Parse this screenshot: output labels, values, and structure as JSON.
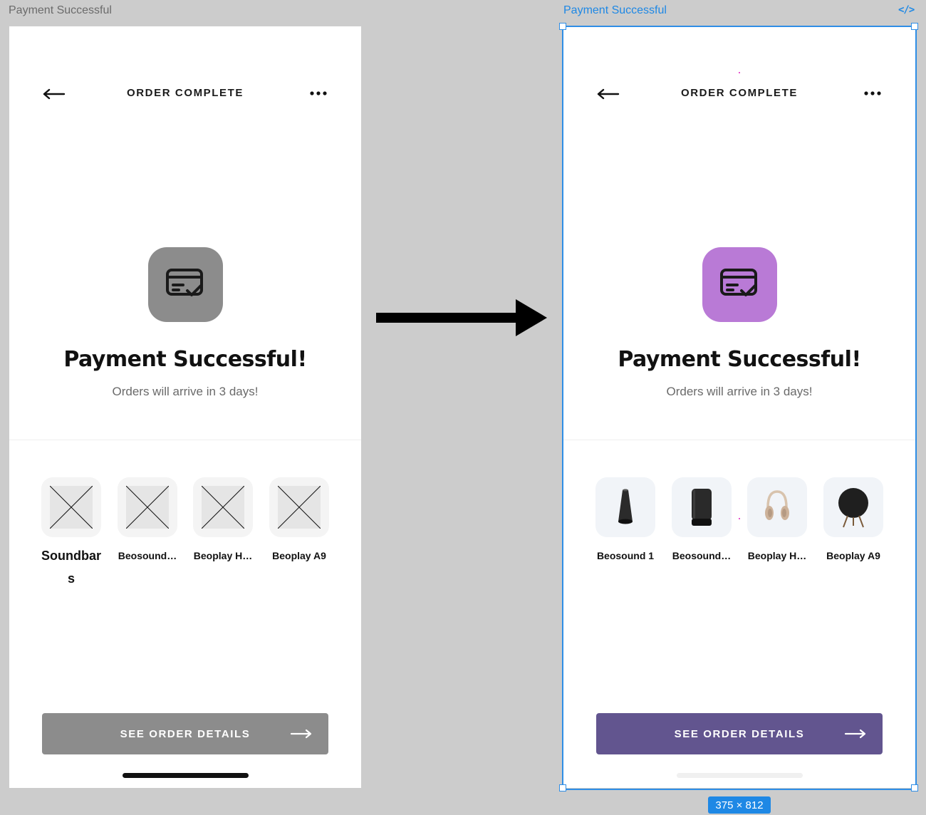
{
  "canvas": {
    "left_frame_label": "Payment Successful",
    "right_frame_label": "Payment Successful",
    "code_icon": "</>",
    "size_badge": "375 × 812"
  },
  "screen": {
    "header_title": "ORDER COMPLETE",
    "back_icon": "arrow-left-icon",
    "more_icon": "more-horizontal-icon",
    "title": "Payment Successful!",
    "subtitle": "Orders will arrive in 3 days!",
    "cta_label": "SEE ORDER DETAILS"
  },
  "left_products": [
    {
      "name": "Soundbars"
    },
    {
      "name": "Beosound…"
    },
    {
      "name": "Beoplay H…"
    },
    {
      "name": "Beoplay A9"
    }
  ],
  "right_products": [
    {
      "name": "Beosound 1"
    },
    {
      "name": "Beosound…"
    },
    {
      "name": "Beoplay H…"
    },
    {
      "name": "Beoplay A9"
    }
  ],
  "colors": {
    "canvas_bg": "#cccccc",
    "selection": "#2f8ee6",
    "left_icon_bg": "#8c8c8c",
    "right_icon_bg": "#b97ad6",
    "left_cta_bg": "#8c8c8c",
    "right_cta_bg": "#62558f"
  }
}
